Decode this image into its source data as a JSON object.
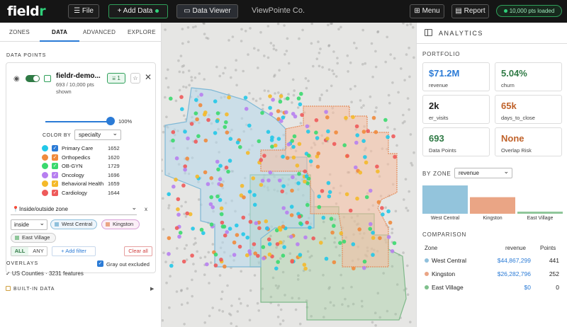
{
  "topbar": {
    "logo": "fieldr",
    "file_label": "File",
    "add_data_label": "+ Add Data",
    "data_viewer_label": "Data Viewer",
    "workspace": "ViewPointe Co.",
    "menu_label": "Menu",
    "report_label": "Report",
    "points_loaded": "10,000 pts loaded",
    "accent_color": "#2fd07a"
  },
  "tabs": [
    {
      "label": "ZONES"
    },
    {
      "label": "DATA"
    },
    {
      "label": "ADVANCED"
    },
    {
      "label": "EXPLORE"
    }
  ],
  "left": {
    "data_points_title": "DATA POINTS",
    "dataset": {
      "name": "fieldr-demo...",
      "count": "693 / 10,000 pts",
      "count_suffix": "shown",
      "filter_count": "1",
      "opacity": "100%",
      "opacity_fraction": 1.0
    },
    "color_by_label": "COLOR BY",
    "color_by_value": "specialty",
    "categories": [
      {
        "label": "Primary Care",
        "count": "1652",
        "color": "#22c8e8",
        "check_color": "#2b7bd6"
      },
      {
        "label": "Orthopedics",
        "count": "1620",
        "color": "#f08a3c",
        "check_color": "#f08a3c"
      },
      {
        "label": "OB-GYN",
        "count": "1729",
        "color": "#3bd96e",
        "check_color": "#3bd96e"
      },
      {
        "label": "Oncology",
        "count": "1696",
        "color": "#b77ff0",
        "check_color": "#b77ff0"
      },
      {
        "label": "Behavioral Health",
        "count": "1659",
        "color": "#f4b92a",
        "check_color": "#f4b92a"
      },
      {
        "label": "Cardiology",
        "count": "1644",
        "color": "#ee5a5a",
        "check_color": "#ee5a5a"
      }
    ],
    "filter_rule": "Inside/outside zone",
    "filter_rule_icon": "pin-icon",
    "filter_op": "inside",
    "filter_x": "x",
    "zone_chips": [
      {
        "label": "West Central",
        "color": "#8fc0dc",
        "border": "#8fc0dc",
        "bg": "#eef5fb"
      },
      {
        "label": "Kingston",
        "color": "#eaa585",
        "border": "#d8a0d8",
        "bg": "#fbeff7"
      },
      {
        "label": "East Village",
        "color": "#8fc79a",
        "border": "#cccccc",
        "bg": "#f5f5f5"
      }
    ],
    "all_label": "ALL",
    "any_label": "ANY",
    "add_filter_label": "+ Add filter",
    "clear_all_label": "Clear all",
    "gray_out_label": "Gray out excluded",
    "overlays_title": "OVERLAYS",
    "overlay_item": "✓ US Counties · 3231 features",
    "builtin_label": "BUILT-IN DATA"
  },
  "analytics": {
    "title": "ANALYTICS",
    "portfolio_title": "PORTFOLIO",
    "kpis": [
      {
        "value": "$71.2M",
        "label": "revenue",
        "color": "#2b7bd6"
      },
      {
        "value": "5.04%",
        "label": "churn",
        "color": "#2f7a45"
      },
      {
        "value": "2k",
        "label": "er_visits",
        "color": "#222222"
      },
      {
        "value": "65k",
        "label": "days_to_close",
        "color": "#c0622a"
      },
      {
        "value": "693",
        "label": "Data Points",
        "color": "#2f7a45"
      },
      {
        "value": "None",
        "label": "Overlap Risk",
        "color": "#c0622a"
      }
    ],
    "by_zone_label": "BY ZONE",
    "by_zone_metric": "revenue",
    "comparison_title": "COMPARISON",
    "comparison_headers": {
      "zone": "Zone",
      "metric": "revenue",
      "points": "Points"
    },
    "zones": [
      {
        "name": "West Central",
        "revenue": "$44,867,299",
        "points": "441",
        "color": "#8fc0dc"
      },
      {
        "name": "Kingston",
        "revenue": "$26,282,796",
        "points": "252",
        "color": "#eaa585"
      },
      {
        "name": "East Village",
        "revenue": "$0",
        "points": "0",
        "color": "#7fc08c"
      }
    ]
  },
  "chart_data": {
    "type": "bar",
    "categories": [
      "West Central",
      "Kingston",
      "East Village"
    ],
    "values": [
      44867299,
      26282796,
      0
    ],
    "colors": [
      "#93c4dc",
      "#eaa585",
      "#8fc79a"
    ]
  }
}
